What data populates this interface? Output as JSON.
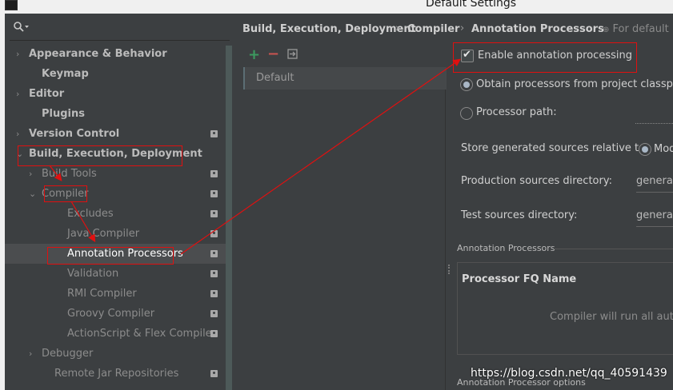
{
  "window": {
    "title": "Default Settings"
  },
  "breadcrumb": [
    "Build, Execution, Deployment",
    "Compiler",
    "Annotation Processors"
  ],
  "breadcrumb_sep": "›",
  "for_default": "For default p",
  "sidebar": {
    "items": [
      {
        "label": "Appearance & Behavior",
        "chev": "›",
        "bold": true,
        "badge": false
      },
      {
        "label": "Keymap",
        "chev": "",
        "bold": true,
        "badge": false
      },
      {
        "label": "Editor",
        "chev": "›",
        "bold": true,
        "badge": false
      },
      {
        "label": "Plugins",
        "chev": "",
        "bold": true,
        "badge": false
      },
      {
        "label": "Version Control",
        "chev": "›",
        "bold": true,
        "badge": true
      },
      {
        "label": "Build, Execution, Deployment",
        "chev": "⌄",
        "bold": true,
        "badge": false
      },
      {
        "label": "Build Tools",
        "chev": "›",
        "bold": false,
        "badge": true
      },
      {
        "label": "Compiler",
        "chev": "⌄",
        "bold": false,
        "badge": true
      },
      {
        "label": "Excludes",
        "chev": "",
        "bold": false,
        "badge": true
      },
      {
        "label": "Java Compiler",
        "chev": "",
        "bold": false,
        "badge": true
      },
      {
        "label": "Annotation Processors",
        "chev": "",
        "bold": false,
        "badge": true,
        "selected": true
      },
      {
        "label": "Validation",
        "chev": "",
        "bold": false,
        "badge": true
      },
      {
        "label": "RMI Compiler",
        "chev": "",
        "bold": false,
        "badge": true
      },
      {
        "label": "Groovy Compiler",
        "chev": "",
        "bold": false,
        "badge": true
      },
      {
        "label": "ActionScript & Flex Compiler",
        "chev": "",
        "bold": false,
        "badge": true
      },
      {
        "label": "Debugger",
        "chev": "›",
        "bold": false,
        "badge": false
      },
      {
        "label": "Remote Jar Repositories",
        "chev": "",
        "bold": false,
        "badge": true
      }
    ]
  },
  "middle": {
    "toolbar": {
      "add": "+",
      "remove": "−"
    },
    "profiles": [
      "Default"
    ]
  },
  "settings": {
    "enable_annotation": "Enable annotation processing",
    "obtain_classpath": "Obtain processors from project classpath",
    "processor_path": "Processor path:",
    "store_generated": "Store generated sources relative to:",
    "store_option": "Mod",
    "production_dir_label": "Production sources directory:",
    "production_dir_value": "generat",
    "test_dir_label": "Test sources directory:",
    "test_dir_value": "generat",
    "annotation_processors_section": "Annotation Processors",
    "table_header": "Processor FQ Name",
    "table_empty": "Compiler will run all autom",
    "options_section": "Annotation Processor options"
  },
  "watermark": "https://blog.csdn.net/qq_40591439",
  "colors": {
    "highlight": "#e01010",
    "accent": "#4a88c7",
    "selection": "#4b4d4f"
  }
}
